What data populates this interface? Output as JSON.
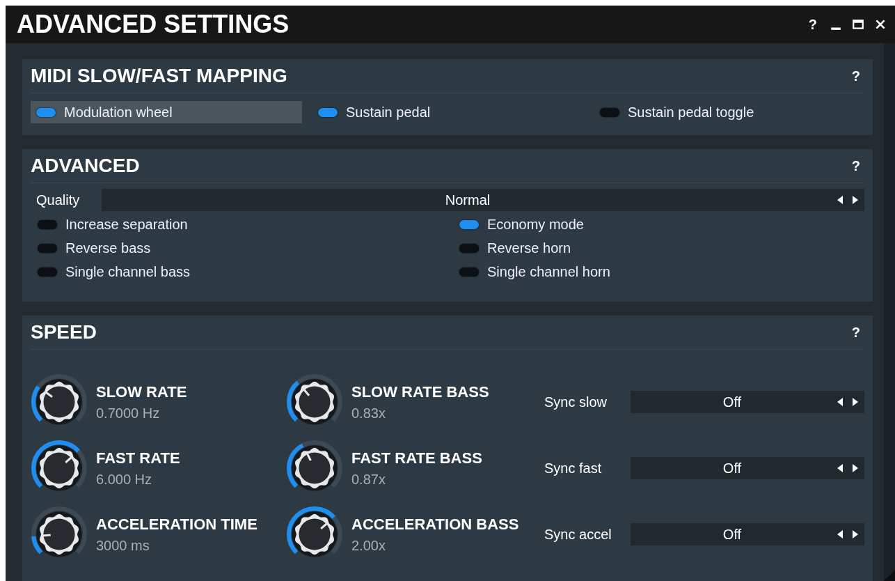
{
  "window": {
    "title": "ADVANCED SETTINGS",
    "buttons": [
      "?"
    ]
  },
  "midi": {
    "title": "MIDI SLOW/FAST MAPPING",
    "help": "?",
    "toggles": [
      {
        "label": "Modulation wheel",
        "on": true,
        "highlighted": true
      },
      {
        "label": "Sustain pedal",
        "on": true,
        "highlighted": false
      },
      {
        "label": "Sustain pedal toggle",
        "on": false,
        "highlighted": false
      }
    ]
  },
  "advanced": {
    "title": "ADVANCED",
    "help": "?",
    "quality": {
      "label": "Quality",
      "value": "Normal"
    },
    "toggles": [
      {
        "label": "Increase separation",
        "on": false
      },
      {
        "label": "Economy mode",
        "on": true
      },
      {
        "label": "Reverse bass",
        "on": false
      },
      {
        "label": "Reverse horn",
        "on": false
      },
      {
        "label": "Single channel bass",
        "on": false
      },
      {
        "label": "Single channel horn",
        "on": false
      }
    ]
  },
  "speed": {
    "title": "SPEED",
    "help": "?",
    "knobs": [
      {
        "label": "SLOW RATE",
        "reading": "0.7000 Hz"
      },
      {
        "label": "SLOW RATE BASS",
        "reading": "0.83x"
      },
      {
        "label": "FAST RATE",
        "reading": "6.000 Hz"
      },
      {
        "label": "FAST RATE BASS",
        "reading": "0.87x"
      },
      {
        "label": "ACCELERATION TIME",
        "reading": "3000 ms"
      },
      {
        "label": "ACCELERATION BASS",
        "reading": "2.00x"
      }
    ],
    "syncs": [
      {
        "label": "Sync slow",
        "value": "Off"
      },
      {
        "label": "Sync fast",
        "value": "Off"
      },
      {
        "label": "Sync accel",
        "value": "Off"
      }
    ]
  }
}
